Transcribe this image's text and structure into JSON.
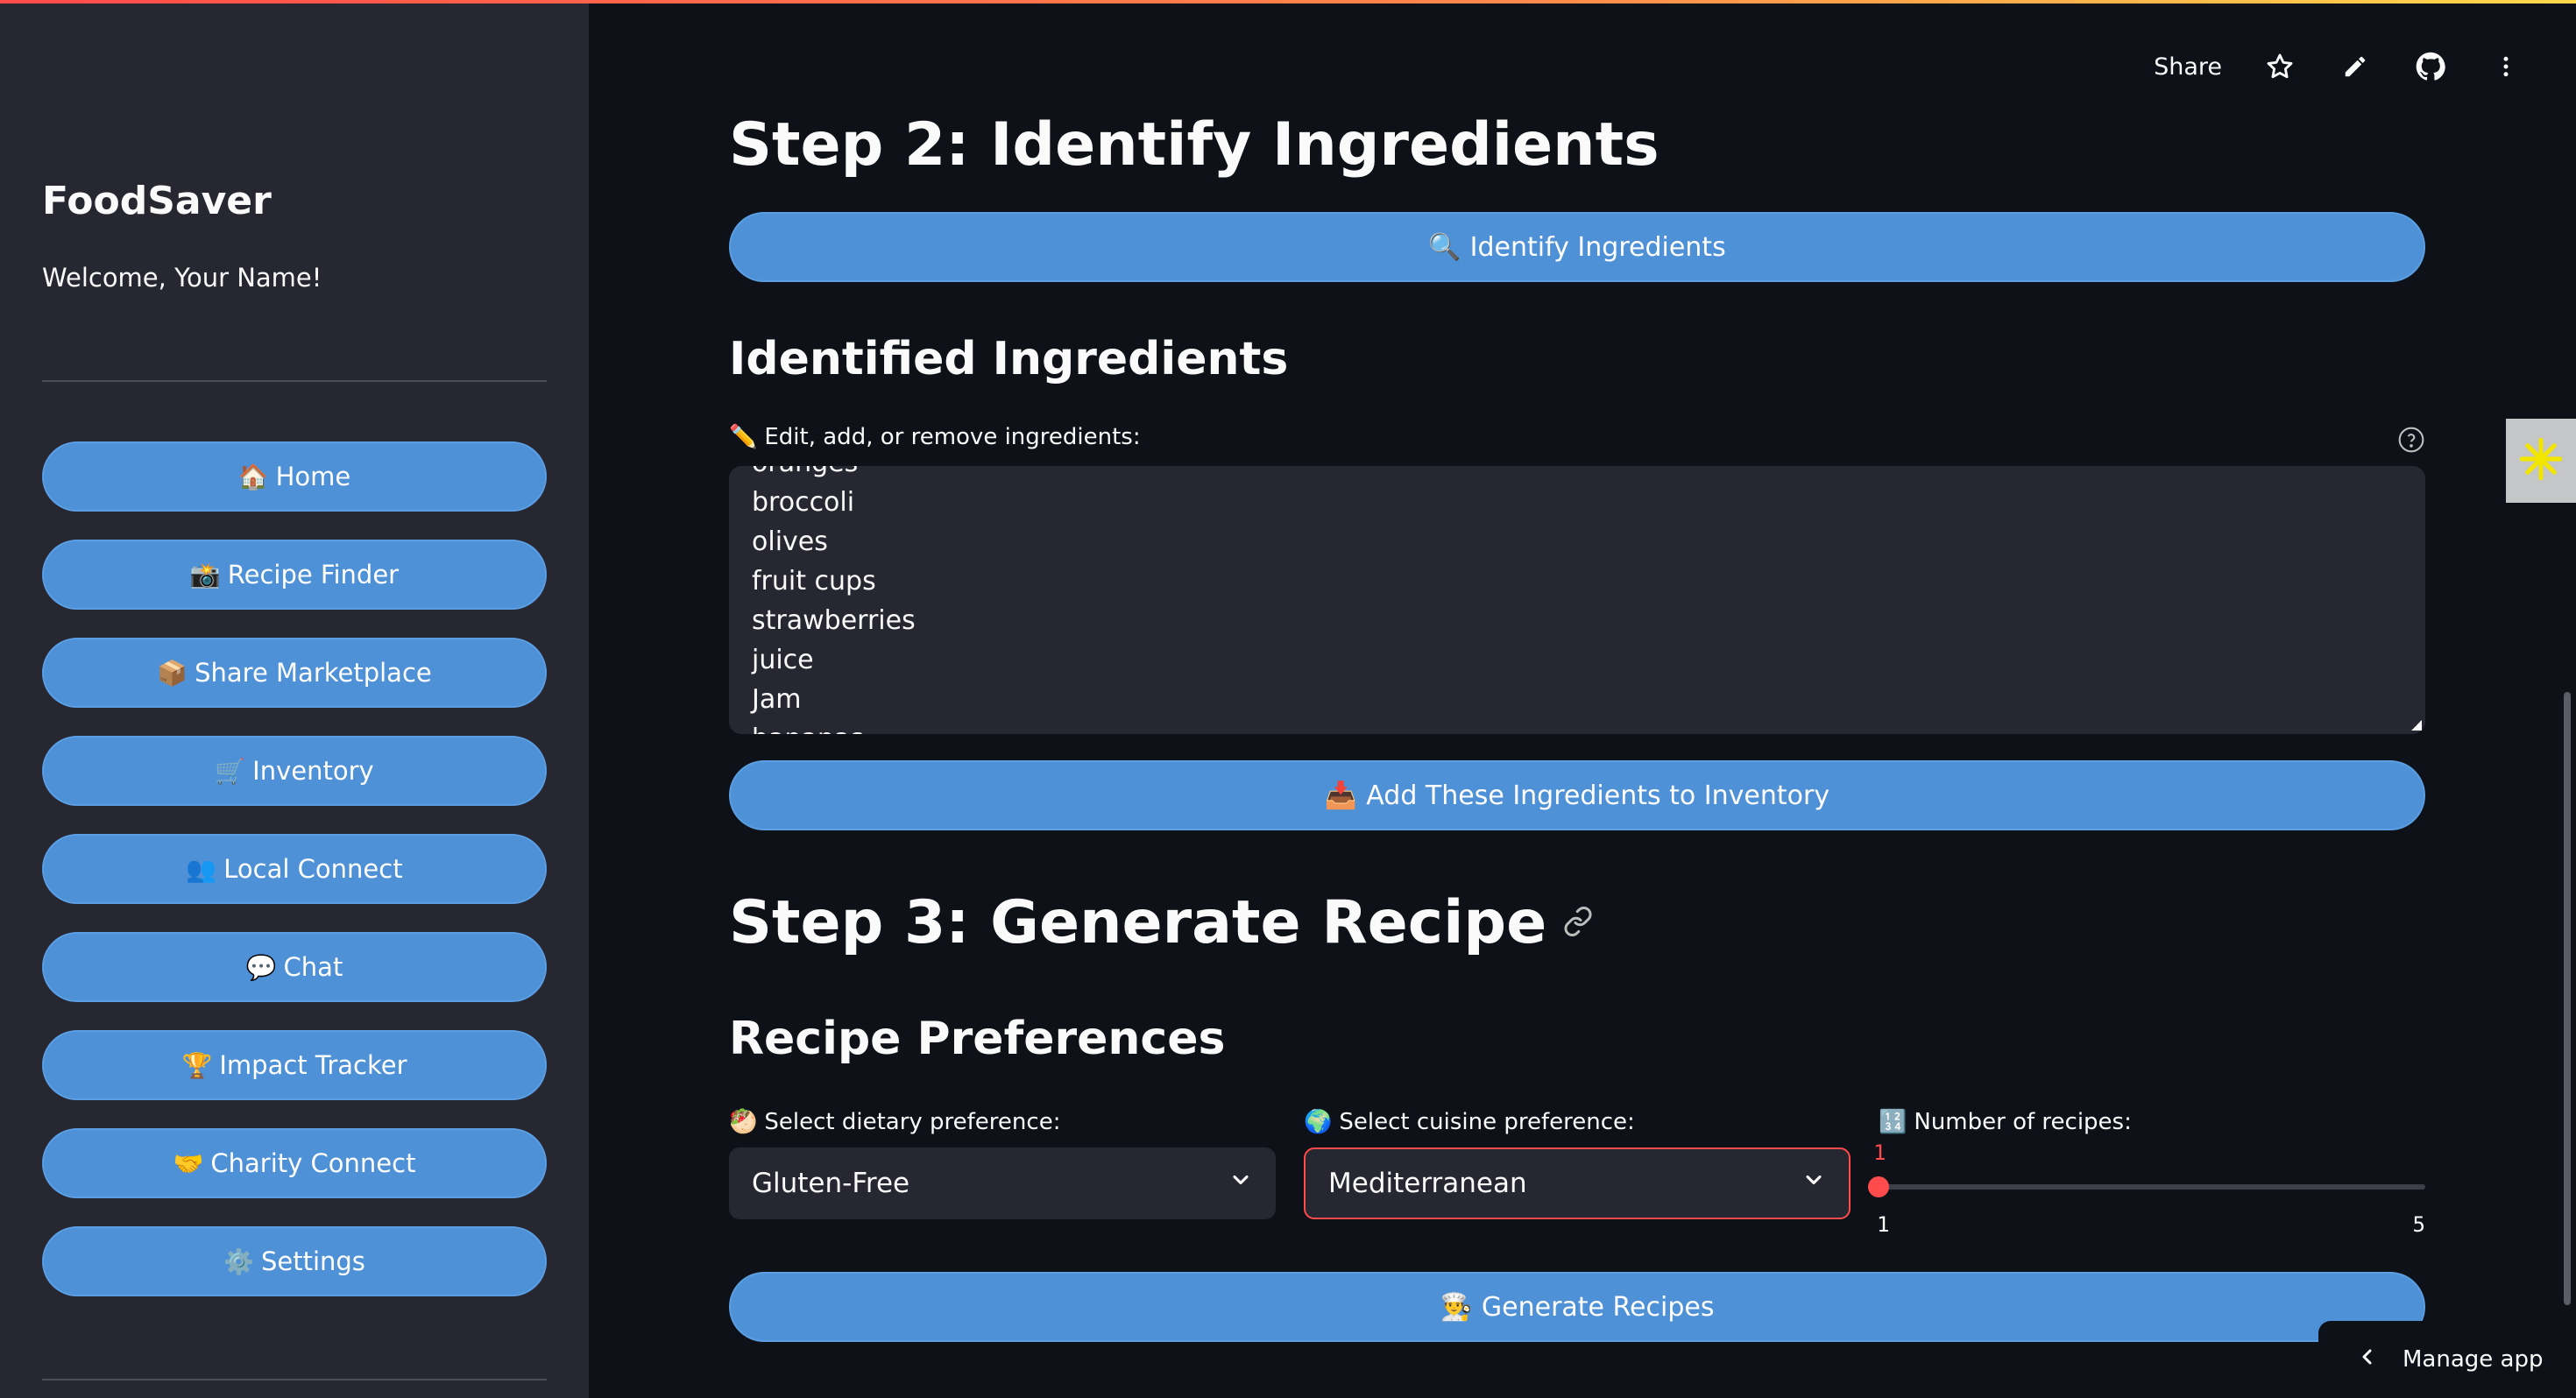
{
  "sidebar": {
    "title": "FoodSaver",
    "welcome": "Welcome, Your Name!",
    "items": [
      {
        "icon": "🏠",
        "label": "Home"
      },
      {
        "icon": "📸",
        "label": "Recipe Finder"
      },
      {
        "icon": "📦",
        "label": "Share Marketplace"
      },
      {
        "icon": "🛒",
        "label": "Inventory"
      },
      {
        "icon": "👥",
        "label": "Local Connect"
      },
      {
        "icon": "💬",
        "label": "Chat"
      },
      {
        "icon": "🏆",
        "label": "Impact Tracker"
      },
      {
        "icon": "🤝",
        "label": "Charity Connect"
      },
      {
        "icon": "⚙️",
        "label": "Settings"
      }
    ]
  },
  "toolbar": {
    "share_label": "Share",
    "icons": [
      "star-icon",
      "pencil-icon",
      "github-icon",
      "more-vertical-icon"
    ]
  },
  "main": {
    "step2_title": "Step 2: Identify Ingredients",
    "identify_button": {
      "icon": "🔍",
      "label": "Identify Ingredients"
    },
    "identified_title": "Identified Ingredients",
    "edit_label": {
      "icon": "✏️",
      "label": "Edit, add, or remove ingredients:"
    },
    "ingredients_text": "oranges\nbroccoli\nolives\nfruit cups\nstrawberries\njuice\nJam\nbananas",
    "add_button": {
      "icon": "📥",
      "label": "Add These Ingredients to Inventory"
    },
    "step3_title": "Step 3: Generate Recipe",
    "prefs_title": "Recipe Preferences",
    "dietary": {
      "icon": "🥙",
      "label": "Select dietary preference:",
      "value": "Gluten-Free"
    },
    "cuisine": {
      "icon": "🌍",
      "label": "Select cuisine preference:",
      "value": "Mediterranean"
    },
    "recipes_count": {
      "icon": "🔢",
      "label": "Number of recipes:",
      "value": "1",
      "min": "1",
      "max": "5"
    },
    "generate_button": {
      "icon": "👨‍🍳",
      "label": "Generate Recipes"
    }
  },
  "footer": {
    "manage_app_label": "Manage app"
  },
  "colors": {
    "accent": "#ff4b4b",
    "button": "#4e91d6",
    "bg": "#0e1117",
    "sidebar": "#262730"
  }
}
